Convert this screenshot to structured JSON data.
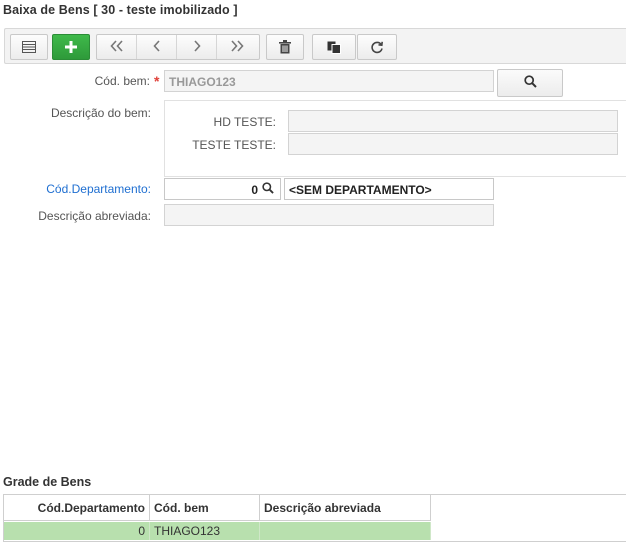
{
  "window": {
    "title": "Baixa de Bens [ 30 - teste imobilizado ]"
  },
  "toolbar": {
    "buttons": [
      "list-icon",
      "add-icon",
      "first-icon",
      "previous-icon",
      "next-icon",
      "last-icon",
      "delete-icon",
      "copy-icon",
      "refresh-icon"
    ]
  },
  "form": {
    "cod_bem": {
      "label": "Cód. bem:",
      "required_mark": "*",
      "value": "THIAGO123"
    },
    "descricao_bem": {
      "label": "Descrição do bem:",
      "hd_teste_label": "HD TESTE:",
      "hd_teste_value": "",
      "teste_teste_label": "TESTE TESTE:",
      "teste_teste_value": ""
    },
    "cod_departamento": {
      "label": "Cód.Departamento:",
      "value": "0",
      "description": "<SEM DEPARTAMENTO>"
    },
    "descricao_abreviada": {
      "label": "Descrição abreviada:",
      "value": ""
    }
  },
  "grid": {
    "title": "Grade de Bens",
    "columns": [
      "Cód.Departamento",
      "Cód. bem",
      "Descrição abreviada"
    ],
    "rows": [
      {
        "cod_departamento": "0",
        "cod_bem": "THIAGO123",
        "descricao_abreviada": ""
      }
    ]
  },
  "colors": {
    "accent_add": "#35a843",
    "link_blue": "#1f6fd1",
    "required_red": "#e0413a",
    "row_selected": "#b8e0ae"
  }
}
